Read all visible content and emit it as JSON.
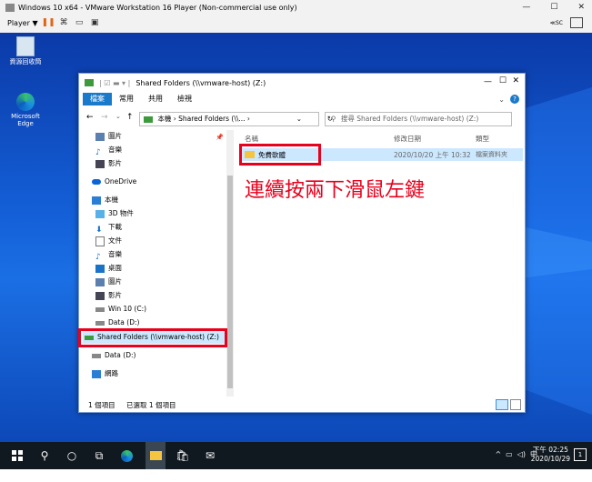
{
  "vmware": {
    "title": "Windows 10 x64 - VMware Workstation 16 Player (Non-commercial use only)",
    "player_label": "Player ▼",
    "esc_label": "≪SC"
  },
  "desktop": {
    "recycle_bin": "資源回收筒",
    "edge": "Microsoft Edge"
  },
  "explorer": {
    "title": "Shared Folders (\\\\vmware-host) (Z:)",
    "tabs": [
      "檔案",
      "常用",
      "共用",
      "檢視"
    ],
    "address": "本機 › Shared Folders (\\\\...  ›",
    "search_placeholder": "搜尋 Shared Folders (\\\\vmware-host) (Z:)",
    "nav": [
      {
        "label": "圖片",
        "icon": "pictures"
      },
      {
        "label": "音樂",
        "icon": "music"
      },
      {
        "label": "影片",
        "icon": "videos"
      },
      {
        "label": "OneDrive",
        "icon": "onedrive"
      },
      {
        "label": "本機",
        "icon": "pc"
      },
      {
        "label": "3D 物件",
        "icon": "3d"
      },
      {
        "label": "下載",
        "icon": "download"
      },
      {
        "label": "文件",
        "icon": "docs"
      },
      {
        "label": "音樂",
        "icon": "music"
      },
      {
        "label": "桌面",
        "icon": "desktop"
      },
      {
        "label": "圖片",
        "icon": "pictures"
      },
      {
        "label": "影片",
        "icon": "videos"
      },
      {
        "label": "Win 10 (C:)",
        "icon": "drive"
      },
      {
        "label": "Data (D:)",
        "icon": "drive"
      },
      {
        "label": "Shared Folders (\\\\vmware-host) (Z:)",
        "icon": "netdrive"
      },
      {
        "label": "Data (D:)",
        "icon": "drive"
      },
      {
        "label": "網路",
        "icon": "network"
      }
    ],
    "columns": {
      "name": "名稱",
      "modified": "修改日期",
      "type": "類型"
    },
    "files": [
      {
        "name": "免費軟體",
        "modified": "2020/10/20 上午 10:32",
        "type": "檔案資料夾"
      }
    ],
    "status_count": "1 個項目",
    "status_selected": "已選取 1 個項目"
  },
  "annotation": "連續按兩下滑鼠左鍵",
  "taskbar": {
    "ime": "中",
    "clock_time": "下午 02:25",
    "clock_date": "2020/10/29",
    "notif_count": "1"
  }
}
